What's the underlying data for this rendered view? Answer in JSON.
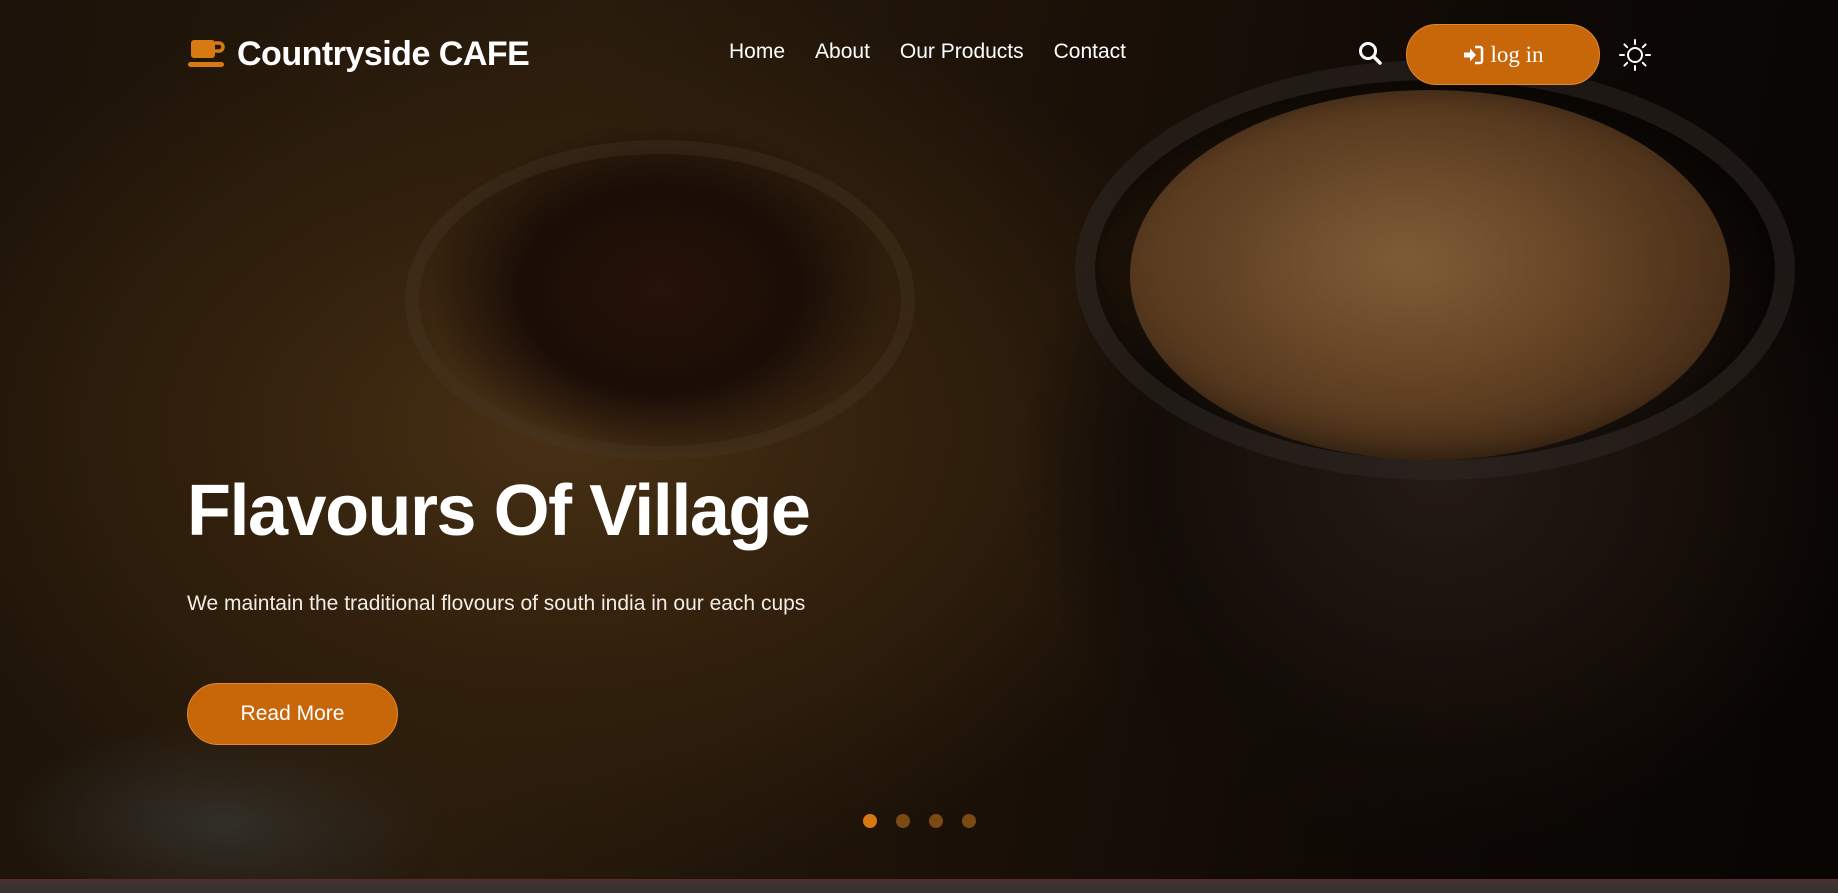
{
  "brand": {
    "name": "Countryside CAFE",
    "icon": "coffee-cup-icon",
    "accent": "#c8660a"
  },
  "nav": {
    "items": [
      {
        "label": "Home"
      },
      {
        "label": "About"
      },
      {
        "label": "Our Products"
      },
      {
        "label": "Contact"
      }
    ]
  },
  "header": {
    "search_icon": "search-icon",
    "login_label": "log in",
    "login_icon": "sign-in-icon",
    "theme_icon": "sun-icon"
  },
  "hero": {
    "title": "Flavours Of Village",
    "subtitle": "We maintain the traditional flovours of south india in our each cups",
    "cta_label": "Read More",
    "slides": {
      "count": 4,
      "active": 1
    }
  }
}
